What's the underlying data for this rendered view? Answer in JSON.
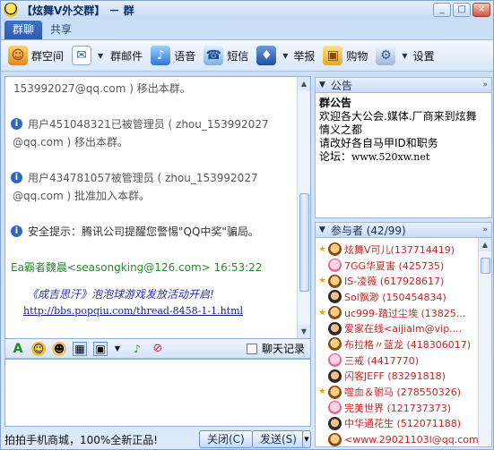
{
  "window": {
    "title": "【炫舞V外交群】 － 群",
    "buttons": [
      "_",
      "□",
      "×"
    ]
  },
  "tabs": [
    {
      "label": "群聊",
      "active": true
    },
    {
      "label": "共享",
      "active": false
    }
  ],
  "toolbar": {
    "items": [
      {
        "label": "群空间",
        "icon": "people-icon",
        "dropdown": false
      },
      {
        "label": "群邮件",
        "icon": "mail-icon",
        "dropdown": true
      },
      {
        "label": "语音",
        "icon": "voice-icon",
        "dropdown": false
      },
      {
        "label": "短信",
        "icon": "phone-icon",
        "dropdown": false
      },
      {
        "label": "举报",
        "icon": "police-icon",
        "dropdown": true
      },
      {
        "label": "购物",
        "icon": "shopping-icon",
        "dropdown": false
      },
      {
        "label": "设置",
        "icon": "gear-icon",
        "dropdown": true
      }
    ]
  },
  "chat": {
    "messages": [
      {
        "type": "cont",
        "text": "153992027@qq.com ) 移出本群。"
      },
      {
        "type": "sys",
        "line1": "用户451048321已被管理员 ( zhou_153992027",
        "line2": "@qq.com ) 移出本群。"
      },
      {
        "type": "sys",
        "line1": "用户434781057被管理员 ( zhou_153992027",
        "line2": "@qq.com ) 批准加入本群。"
      },
      {
        "type": "tip",
        "text": "安全提示：腾讯公司提醒您警惕\"QQ中奖\"骗局。"
      },
      {
        "type": "sender",
        "text": "Ea霸者魏晨<seasongking@126.com> 16:53:22"
      },
      {
        "type": "ad_title",
        "text": "《成吉思汗》泡泡球游戏发放活动开启!"
      },
      {
        "type": "link",
        "text": "http://bbs.popqiu.com/thread-8458-1-1.html"
      }
    ],
    "history_label": "聊天记录"
  },
  "bottom": {
    "ad_text": "拍拍手机商城，100%全新正品!",
    "close_label": "关闭(C)",
    "send_label": "发送(S)"
  },
  "notice": {
    "header": "公告",
    "title": "群公告",
    "lines": [
      "欢迎各大公会.媒体.厂商来到炫舞",
      "情义之都",
      "请改好各自马甲ID和职务"
    ],
    "forum_prefix": "论坛：",
    "forum_url": "www.520xw.net"
  },
  "members": {
    "header": "参与者 (42/99)",
    "list": [
      {
        "name": "炫舞V可儿(137714419)",
        "crown": true,
        "avatar": "normal"
      },
      {
        "name": "7GG华夏害 (425735)",
        "crown": false,
        "avatar": "pink"
      },
      {
        "name": "IS-凌薇 (617928617)",
        "crown": true,
        "avatar": "normal"
      },
      {
        "name": "Sol飘渺 (150454834)",
        "crown": false,
        "avatar": "dark"
      },
      {
        "name": "uc999-踏过尘埃 (13825...",
        "crown": true,
        "avatar": "normal"
      },
      {
        "name": "爱家在线<aijialm@vip....",
        "crown": false,
        "avatar": "dark"
      },
      {
        "name": "布拉格〃蓝龙 (418306017)",
        "crown": false,
        "avatar": "normal"
      },
      {
        "name": "三戒 (4417770)",
        "crown": false,
        "avatar": "pink"
      },
      {
        "name": "闪客JEFF (83291818)",
        "crown": false,
        "avatar": "dark"
      },
      {
        "name": "噬血＆驸马 (278550326)",
        "crown": true,
        "avatar": "normal"
      },
      {
        "name": "完美世界 (121737373)",
        "crown": false,
        "avatar": "pink"
      },
      {
        "name": "中华通花生 (512071188)",
        "crown": false,
        "avatar": "dark"
      },
      {
        "name": "<www.29021103l@qq.com>",
        "crown": false,
        "avatar": "normal"
      }
    ]
  }
}
